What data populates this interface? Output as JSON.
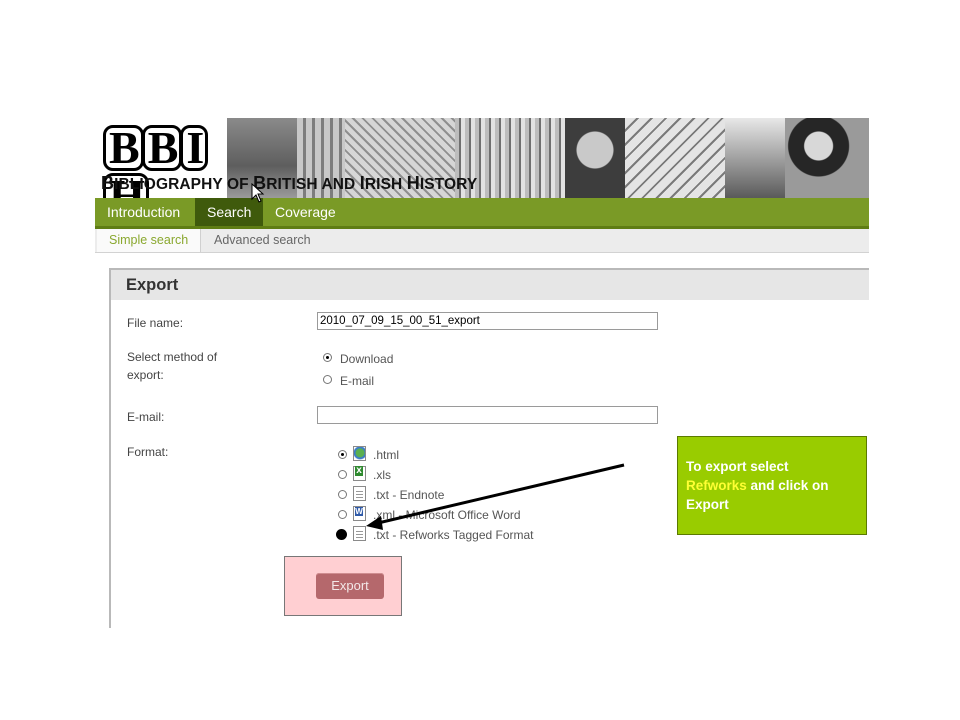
{
  "banner": {
    "logo_letters": [
      "B",
      "B",
      "I",
      "H"
    ],
    "title_parts": [
      {
        "text": "B",
        "big": true
      },
      {
        "text": "IBLIOGRAPHY OF ",
        "big": false
      },
      {
        "text": "B",
        "big": true
      },
      {
        "text": "RITISH AND ",
        "big": false
      },
      {
        "text": "I",
        "big": true
      },
      {
        "text": "RISH ",
        "big": false
      },
      {
        "text": "H",
        "big": true
      },
      {
        "text": "ISTORY",
        "big": false
      }
    ]
  },
  "nav": {
    "tabs": [
      {
        "label": "Introduction",
        "active": false
      },
      {
        "label": "Search",
        "active": true
      },
      {
        "label": "Coverage",
        "active": false
      }
    ]
  },
  "subnav": {
    "tabs": [
      {
        "label": "Simple search",
        "active": true
      },
      {
        "label": "Advanced search",
        "active": false
      }
    ]
  },
  "export": {
    "title": "Export",
    "filename_label": "File name:",
    "filename_value": "2010_07_09_15_00_51_export",
    "method_label_line1": "Select method of",
    "method_label_line2": "export:",
    "methods": [
      {
        "label": "Download",
        "selected": true
      },
      {
        "label": "E-mail",
        "selected": false
      }
    ],
    "email_label": "E-mail:",
    "email_value": "",
    "format_label": "Format:",
    "formats": [
      {
        "label": ".html",
        "icon": "html-file-icon",
        "selected": true
      },
      {
        "label": ".xls",
        "icon": "excel-file-icon",
        "selected": false
      },
      {
        "label": ".txt - Endnote",
        "icon": "text-file-icon",
        "selected": false
      },
      {
        "label": ".xml - Microsoft Office Word",
        "icon": "word-file-icon",
        "selected": false
      },
      {
        "label": ".txt - Refworks Tagged Format",
        "icon": "text-file-icon",
        "selected": false
      }
    ],
    "export_button": "Export"
  },
  "callout": {
    "line1": "To export select",
    "highlight": "Refworks",
    "line2": " and click on",
    "line3": "Export"
  },
  "colors": {
    "nav_green": "#7a9a26",
    "nav_active": "#3f5a0c",
    "callout_green": "#99cc00",
    "callout_highlight": "#ffff33",
    "export_button": "#b5686c",
    "export_highlight": "#ffcfd2"
  }
}
